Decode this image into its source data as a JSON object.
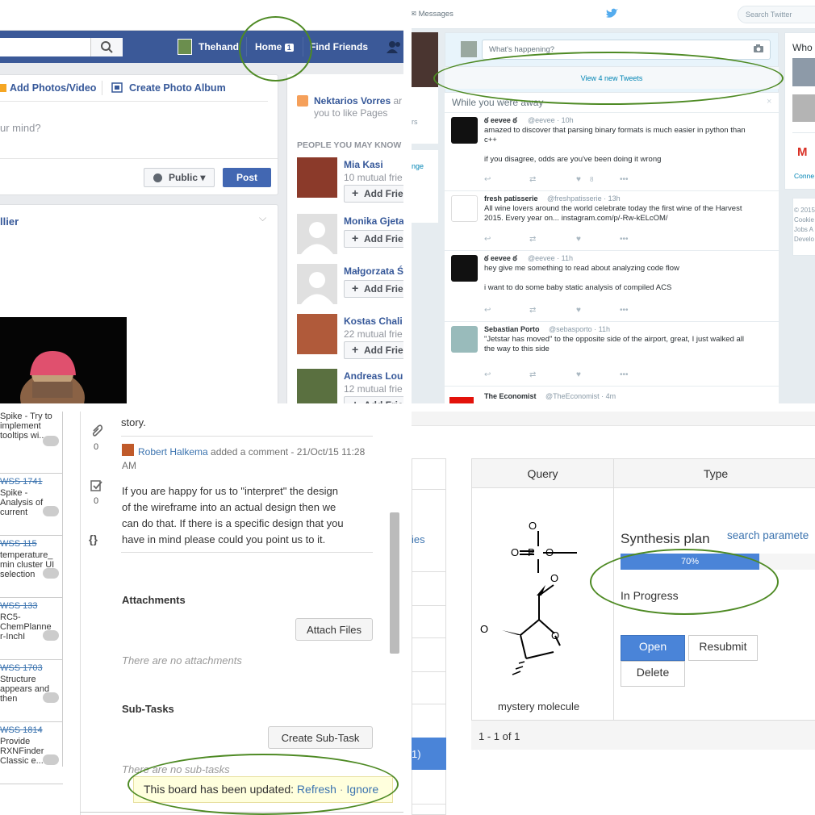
{
  "facebook": {
    "user": "Thehand",
    "home": "Home",
    "home_badge": "1",
    "find_friends": "Find Friends",
    "add_photos": "Add Photos/Video",
    "create_album": "Create Photo Album",
    "status_placeholder": "ur mind?",
    "public": "Public",
    "post": "Post",
    "feed_name": "llier",
    "notice_name": "Nektarios Vorres",
    "notice_text1": "ar",
    "notice_text2": "you to like Pages",
    "pymk_header": "PEOPLE YOU MAY KNOW",
    "people": [
      {
        "name": "Mia Kasi",
        "sub": "10 mutual frie",
        "add": "Add Frie"
      },
      {
        "name": "Monika Gjeta",
        "sub": "",
        "add": "Add Frie"
      },
      {
        "name": "Małgorzata Ś",
        "sub": "",
        "add": "Add Frie"
      },
      {
        "name": "Kostas Chali",
        "sub": "22 mutual frie",
        "add": "Add Frie"
      },
      {
        "name": "Andreas Lou",
        "sub": "12 mutual frie",
        "add": "Add Frie"
      }
    ]
  },
  "twitter": {
    "messages": "Messages",
    "search_placeholder": "Search Twitter",
    "compose_placeholder": "What's happening?",
    "new_tweets": "View 4 new Tweets",
    "away": "While you were away",
    "close": "×",
    "side_frag1": "rs",
    "side_frag2": "nge",
    "who": "Who",
    "connect": "Conne",
    "footer": [
      "© 2015",
      "Cookie",
      "Jobs A",
      "Develo"
    ],
    "tweets": [
      {
        "name": "ఠ eevee ఠ",
        "handle": "@eevee · 10h",
        "lines": [
          "amazed to discover that parsing binary formats is much easier in python than",
          "c++",
          "",
          "if you disagree, odds are you've been doing it wrong"
        ],
        "likes": "8"
      },
      {
        "name": "fresh patisserie",
        "handle": "@freshpatisserie · 13h",
        "lines": [
          "All wine lovers around the world celebrate today the first wine of the Harvest",
          "2015. Every year on... instagram.com/p/-Rw-kELcOM/"
        ],
        "likes": ""
      },
      {
        "name": "ఠ eevee ఠ",
        "handle": "@eevee · 11h",
        "lines": [
          "hey give me something to read about analyzing code flow",
          "",
          "i want to do some baby static analysis of compiled ACS"
        ],
        "likes": ""
      },
      {
        "name": "Sebastian Porto",
        "handle": "@sebasporto · 11h",
        "lines": [
          "\"Jetstar has moved\" to the opposite side of the airport, great, I just walked all",
          "the way to this side"
        ],
        "likes": ""
      }
    ],
    "last_name": "The Economist",
    "last_handle": "@TheEconomist · 4m"
  },
  "jira": {
    "cards": [
      {
        "key": "",
        "lines": [
          "Spike - Try to",
          "implement",
          "tooltips wi..."
        ]
      },
      {
        "key": "WSS 1741",
        "lines": [
          "Spike -",
          "Analysis of",
          "current"
        ]
      },
      {
        "key": "WSS 115",
        "lines": [
          "temperature_",
          "min cluster UI",
          "selection"
        ]
      },
      {
        "key": "WSS 133",
        "lines": [
          "RC5-",
          "ChemPlanne",
          "r-InchI"
        ]
      },
      {
        "key": "WSS 1703",
        "lines": [
          "Structure",
          "appears and",
          "then"
        ]
      },
      {
        "key": "WSS 1814",
        "lines": [
          "Provide",
          "RXNFinder",
          "Classic e..."
        ]
      }
    ],
    "attach_count": "0",
    "check_count": "0",
    "json_icon": "{}",
    "story": "story.",
    "commenter": "Robert Halkema",
    "comment_meta": " added a comment - 21/Oct/15 11:28",
    "comment_meta2": "AM",
    "comment": [
      "If you are happy for us to \"interpret\" the design",
      "of the wireframe into an actual design then we",
      "can do that. If there is a specific design that you",
      "have in mind please could you point us to it."
    ],
    "attachments": "Attachments",
    "attach_files": "Attach Files",
    "no_attach": "There are no attachments",
    "subtasks": "Sub-Tasks",
    "create_subtask": "Create Sub-Task",
    "no_subtasks": "There are no sub-tasks",
    "updated": "This board has been updated: ",
    "refresh": "Refresh",
    "dot": " · ",
    "ignore": "Ignore"
  },
  "synthesis": {
    "side_link": "ies",
    "side_active": "1)",
    "col_query": "Query",
    "col_type": "Type",
    "title": "Synthesis plan",
    "search_link": "search paramete",
    "progress": 0.7,
    "progress_label": "70%",
    "status": "In Progress",
    "open": "Open",
    "resubmit": "Resubmit",
    "delete": "Delete",
    "molecule_name": "mystery molecule",
    "pager": "1 - 1 of 1",
    "atoms": {
      "o1": "O",
      "o2": "O",
      "p": "P",
      "o3": "O",
      "o4": "O",
      "o5": "O",
      "o6": "O"
    }
  }
}
